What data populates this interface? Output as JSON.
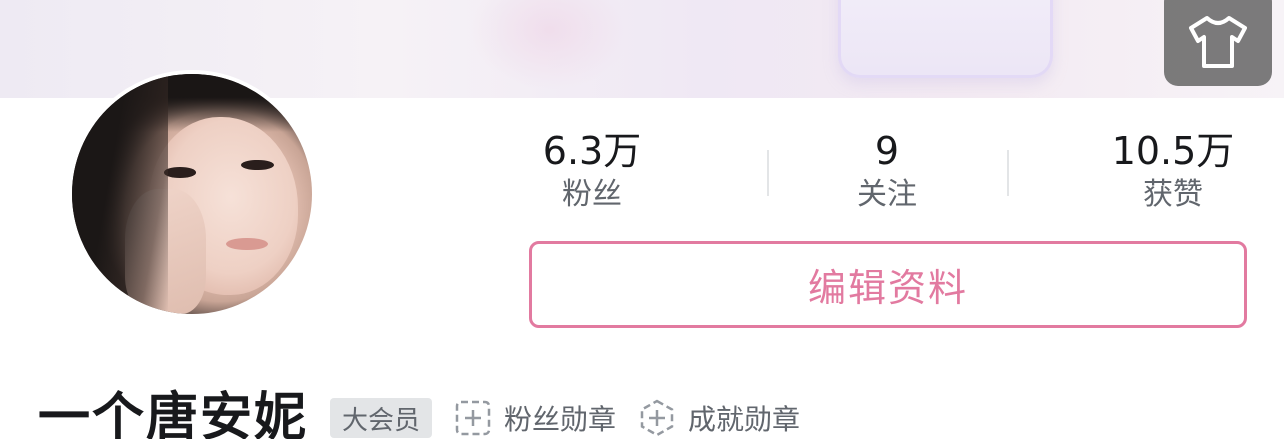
{
  "profile": {
    "username": "一个唐安妮",
    "vip_badge": "大会员",
    "edit_button": "编辑资料",
    "medals": [
      {
        "label": "粉丝勋章",
        "icon": "square-plus-dashed-icon"
      },
      {
        "label": "成就勋章",
        "icon": "hexagon-plus-dashed-icon"
      }
    ]
  },
  "stats": [
    {
      "value": "6.3万",
      "label": "粉丝"
    },
    {
      "value": "9",
      "label": "关注"
    },
    {
      "value": "10.5万",
      "label": "获赞"
    }
  ],
  "header": {
    "skin_icon": "t-shirt-icon"
  },
  "colors": {
    "accent_pink": "#e27aa0",
    "text_primary": "#18191c",
    "text_secondary": "#61666d",
    "divider": "#e3e5e7"
  }
}
